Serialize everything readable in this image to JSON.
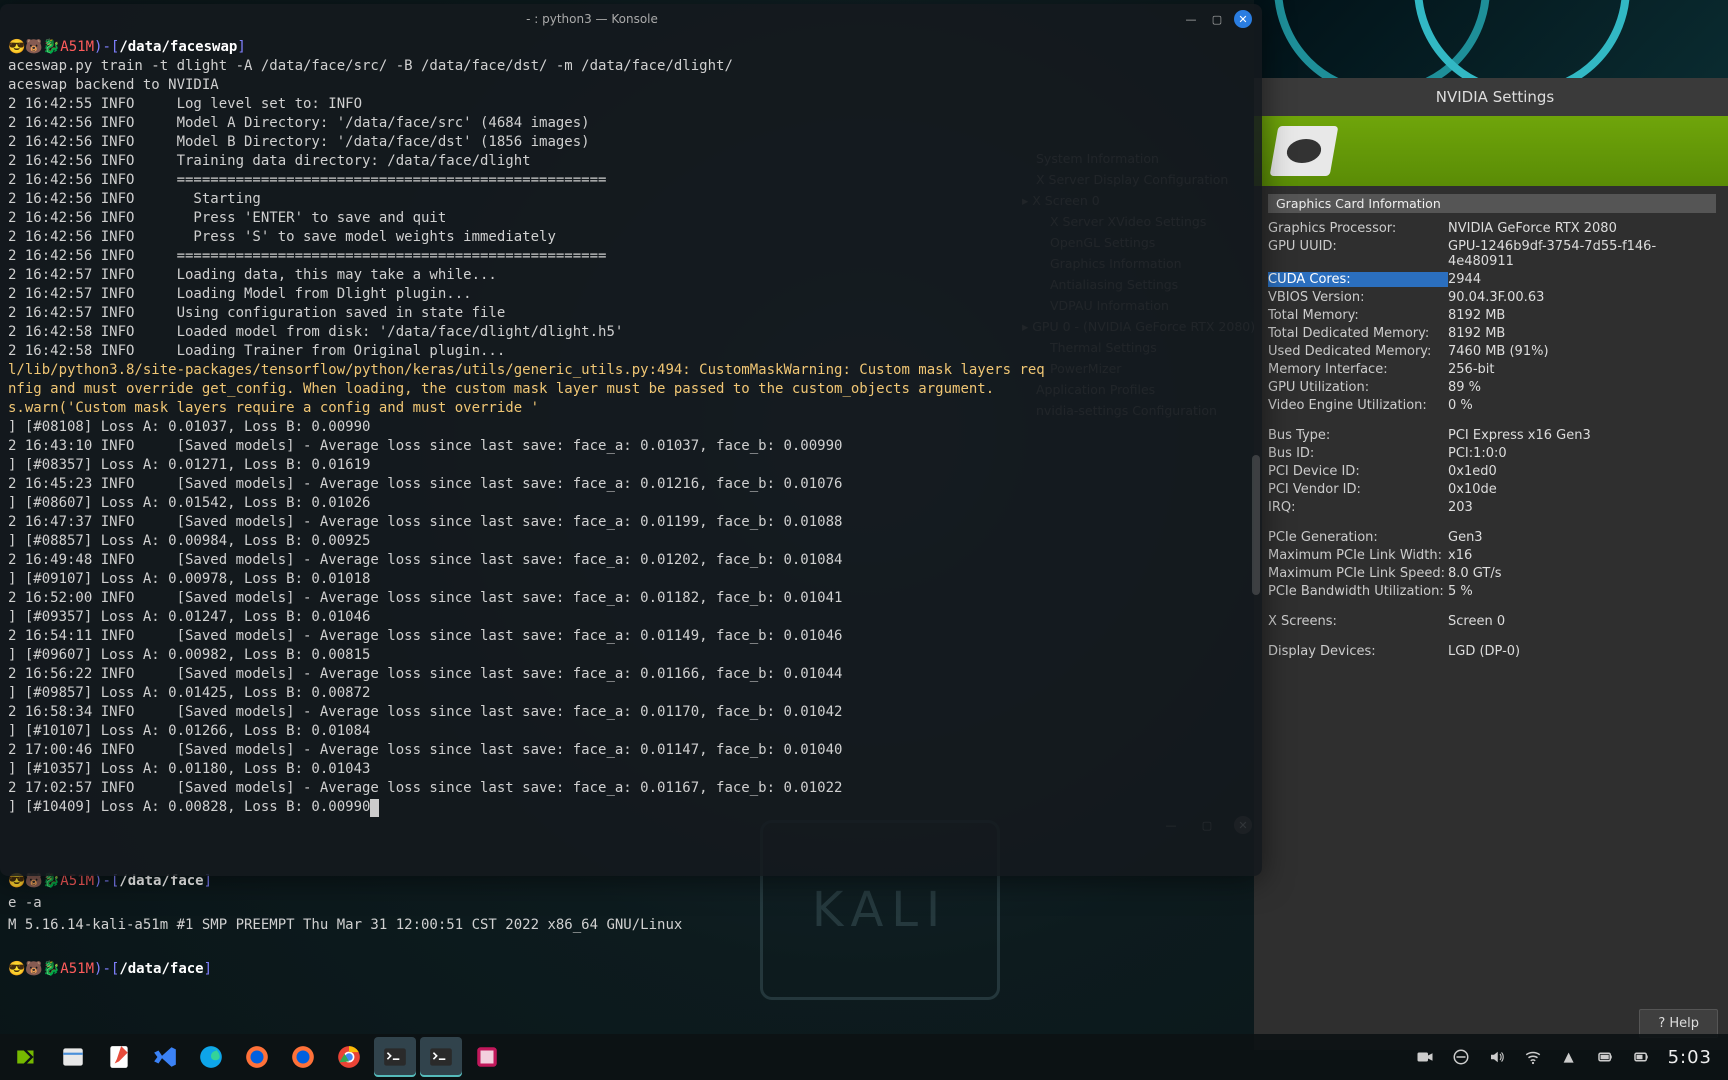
{
  "konsole": {
    "title": "- : python3 — Konsole",
    "prompt_emoji": "😎🐻🐉",
    "prompt_user": "A51M",
    "prompt_sep": ")-[",
    "prompt_path": "/data/faceswap",
    "cmd": "aceswap.py train -t dlight -A /data/face/src/ -B /data/face/dst/ -m /data/face/dlight/",
    "lines_backend": "aceswap backend to NVIDIA",
    "log": [
      "2 16:42:55 INFO     Log level set to: INFO",
      "2 16:42:56 INFO     Model A Directory: '/data/face/src' (4684 images)",
      "2 16:42:56 INFO     Model B Directory: '/data/face/dst' (1856 images)",
      "2 16:42:56 INFO     Training data directory: /data/face/dlight",
      "2 16:42:56 INFO     ===================================================",
      "2 16:42:56 INFO       Starting",
      "2 16:42:56 INFO       Press 'ENTER' to save and quit",
      "2 16:42:56 INFO       Press 'S' to save model weights immediately",
      "2 16:42:56 INFO     ===================================================",
      "2 16:42:57 INFO     Loading data, this may take a while...",
      "2 16:42:57 INFO     Loading Model from Dlight plugin...",
      "2 16:42:57 INFO     Using configuration saved in state file",
      "2 16:42:58 INFO     Loaded model from disk: '/data/face/dlight/dlight.h5'",
      "2 16:42:58 INFO     Loading Trainer from Original plugin..."
    ],
    "warn1": "l/lib/python3.8/site-packages/tensorflow/python/keras/utils/generic_utils.py:494: CustomMaskWarning: Custom mask layers req",
    "warn2": "nfig and must override get_config. When loading, the custom mask layer must be passed to the custom_objects argument.",
    "warn3": "s.warn('Custom mask layers require a config and must override '",
    "train": [
      "] [#08108] Loss A: 0.01037, Loss B: 0.00990",
      "2 16:43:10 INFO     [Saved models] - Average loss since last save: face_a: 0.01037, face_b: 0.00990",
      "] [#08357] Loss A: 0.01271, Loss B: 0.01619",
      "2 16:45:23 INFO     [Saved models] - Average loss since last save: face_a: 0.01216, face_b: 0.01076",
      "] [#08607] Loss A: 0.01542, Loss B: 0.01026",
      "2 16:47:37 INFO     [Saved models] - Average loss since last save: face_a: 0.01199, face_b: 0.01088",
      "] [#08857] Loss A: 0.00984, Loss B: 0.00925",
      "2 16:49:48 INFO     [Saved models] - Average loss since last save: face_a: 0.01202, face_b: 0.01084",
      "] [#09107] Loss A: 0.00978, Loss B: 0.01018",
      "2 16:52:00 INFO     [Saved models] - Average loss since last save: face_a: 0.01182, face_b: 0.01041",
      "] [#09357] Loss A: 0.01247, Loss B: 0.01046",
      "2 16:54:11 INFO     [Saved models] - Average loss since last save: face_a: 0.01149, face_b: 0.01046",
      "] [#09607] Loss A: 0.00982, Loss B: 0.00815",
      "2 16:56:22 INFO     [Saved models] - Average loss since last save: face_a: 0.01166, face_b: 0.01044",
      "] [#09857] Loss A: 0.01425, Loss B: 0.00872",
      "2 16:58:34 INFO     [Saved models] - Average loss since last save: face_a: 0.01170, face_b: 0.01042",
      "] [#10107] Loss A: 0.01266, Loss B: 0.01084",
      "2 17:00:46 INFO     [Saved models] - Average loss since last save: face_a: 0.01147, face_b: 0.01040",
      "] [#10357] Loss A: 0.01180, Loss B: 0.01043",
      "2 17:02:57 INFO     [Saved models] - Average loss since last save: face_a: 0.01167, face_b: 0.01022",
      "] [#10409] Loss A: 0.00828, Loss B: 0.00990"
    ]
  },
  "bgterm": {
    "prompt_path": "/data/face",
    "cmd": "e -a",
    "uname": "M 5.16.14-kali-a51m #1 SMP PREEMPT Thu Mar 31 12:00:51 CST 2022 x86_64 GNU/Linux"
  },
  "nvidia": {
    "title": "NVIDIA Settings",
    "tree": [
      {
        "l": 0,
        "t": ""
      },
      {
        "l": 1,
        "t": "System Information"
      },
      {
        "l": 1,
        "t": "X Server Display Configuration"
      },
      {
        "l": 0,
        "t": "▸ X Screen 0"
      },
      {
        "l": 2,
        "t": "X Server XVideo Settings"
      },
      {
        "l": 2,
        "t": "OpenGL Settings"
      },
      {
        "l": 2,
        "t": "Graphics Information"
      },
      {
        "l": 2,
        "t": "Antialiasing Settings"
      },
      {
        "l": 2,
        "t": "VDPAU Information"
      },
      {
        "l": 0,
        "t": "▸ GPU 0 - (NVIDIA GeForce RTX 2080)"
      },
      {
        "l": 2,
        "t": "Thermal Settings"
      },
      {
        "l": 2,
        "t": "PowerMizer"
      },
      {
        "l": 1,
        "t": "Application Profiles"
      },
      {
        "l": 1,
        "t": "nvidia-settings Configuration"
      }
    ],
    "section": "Graphics Card Information",
    "rows1": [
      {
        "k": "Graphics Processor:",
        "v": "NVIDIA GeForce RTX 2080"
      },
      {
        "k": "GPU UUID:",
        "v": "GPU-1246b9df-3754-7d55-f146-4e480911"
      },
      {
        "k": "CUDA Cores:",
        "v": "2944",
        "hl": true
      },
      {
        "k": "VBIOS Version:",
        "v": "90.04.3F.00.63"
      },
      {
        "k": "Total Memory:",
        "v": "8192 MB"
      },
      {
        "k": "Total Dedicated Memory:",
        "v": "8192 MB"
      },
      {
        "k": "Used Dedicated Memory:",
        "v": "7460 MB (91%)"
      },
      {
        "k": "Memory Interface:",
        "v": "256-bit"
      },
      {
        "k": "GPU Utilization:",
        "v": "89 %"
      },
      {
        "k": "Video Engine Utilization:",
        "v": "0 %"
      }
    ],
    "rows2": [
      {
        "k": "Bus Type:",
        "v": "PCI Express x16 Gen3"
      },
      {
        "k": "Bus ID:",
        "v": "PCI:1:0:0"
      },
      {
        "k": "PCI Device ID:",
        "v": "0x1ed0"
      },
      {
        "k": "PCI Vendor ID:",
        "v": "0x10de"
      },
      {
        "k": "IRQ:",
        "v": "203"
      }
    ],
    "rows3": [
      {
        "k": "PCIe Generation:",
        "v": "Gen3"
      },
      {
        "k": "Maximum PCIe Link Width:",
        "v": "x16"
      },
      {
        "k": "Maximum PCIe Link Speed:",
        "v": "8.0 GT/s"
      },
      {
        "k": "PCIe Bandwidth Utilization:",
        "v": "5 %"
      }
    ],
    "rows4": [
      {
        "k": "X Screens:",
        "v": "Screen 0"
      }
    ],
    "rows5": [
      {
        "k": "Display Devices:",
        "v": "LGD (DP-0)"
      }
    ],
    "help": "Help"
  },
  "taskbar": {
    "time": "5:03"
  }
}
